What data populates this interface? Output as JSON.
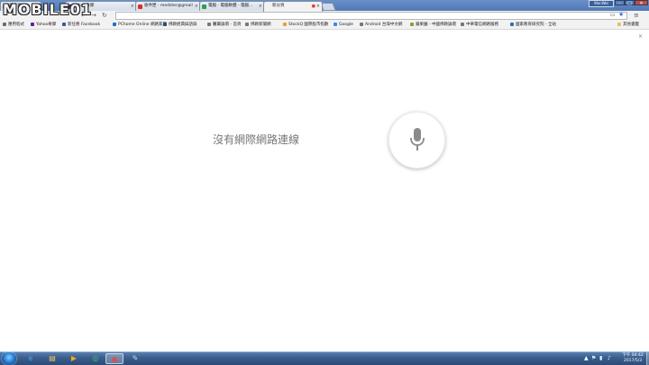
{
  "brand": {
    "watermark": "MOBILE01"
  },
  "window": {
    "user": "WenWei",
    "minimize": "–",
    "maximize": "□",
    "close": "✕"
  },
  "tabs": [
    {
      "label": "新分頁",
      "favicon_color": "#7a7a7a",
      "active": false
    },
    {
      "label": "Yahoo奇摩",
      "favicon_color": "#5f1f9e",
      "active": false
    },
    {
      "label": "收件匣 - medster@gmail",
      "favicon_color": "#d93025",
      "active": false
    },
    {
      "label": "電腦 - 電腦軟體 - 電腦…",
      "favicon_color": "#2e9e4a",
      "active": false
    },
    {
      "label": "新分頁",
      "favicon_color": "#e53935",
      "active": true
    }
  ],
  "toolbar": {
    "back": "←",
    "forward": "→",
    "reload": "↻",
    "omnibox_value": "",
    "cast_icon": "▭",
    "star_icon": "★",
    "menu_icon": "≡"
  },
  "bookmarks": [
    {
      "label": "應用程式",
      "icon_color": "#6d6d6d"
    },
    {
      "label": "Yahoo奇摩",
      "icon_color": "#5f1f9e"
    },
    {
      "label": "新任務 Facebook",
      "icon_color": "#3b5998"
    },
    {
      "label": "PChome Online 網路家庭",
      "icon_color": "#1a73c8"
    },
    {
      "label": "佛教經典與語錄",
      "icon_color": "#2d4a7a"
    },
    {
      "label": "醫藥論壇 - 首頁",
      "icon_color": "#777777"
    },
    {
      "label": "佛教新聞網",
      "icon_color": "#777777"
    },
    {
      "label": "StockQ 國際股市指數",
      "icon_color": "#e2a33a"
    },
    {
      "label": "Google",
      "icon_color": "#4285f4"
    },
    {
      "label": "Android 台灣中文網",
      "icon_color": "#777777"
    },
    {
      "label": "蘋果園 - 中國佛教論壇",
      "icon_color": "#8aa12c"
    },
    {
      "label": "中華電信網路服務",
      "icon_color": "#777777"
    },
    {
      "label": "國家教育研究院 - 全站",
      "icon_color": "#3a6bb0"
    },
    {
      "label": "其他書籤",
      "icon_color": "#e8c15a"
    }
  ],
  "infobar": {
    "close_icon": "×"
  },
  "page": {
    "offline_message": "沒有網際網路連線"
  },
  "taskbar": {
    "apps": [
      {
        "name": "internet-explorer",
        "glyph": "e",
        "color": "#3fa9f5"
      },
      {
        "name": "file-explorer",
        "glyph": "▤",
        "color": "#f2c35a"
      },
      {
        "name": "media-player",
        "glyph": "▶",
        "color": "#f5a623"
      },
      {
        "name": "line",
        "glyph": "◎",
        "color": "#3acb53"
      },
      {
        "name": "chrome",
        "glyph": "◉",
        "color": "#e4483b"
      },
      {
        "name": "tool",
        "glyph": "✎",
        "color": "#cfd9e6"
      }
    ],
    "tray_flag": "▲",
    "tray_icons": [
      "⚑",
      "▮",
      "♪"
    ],
    "time": "下午 04:42",
    "date": "2017/5/3"
  }
}
